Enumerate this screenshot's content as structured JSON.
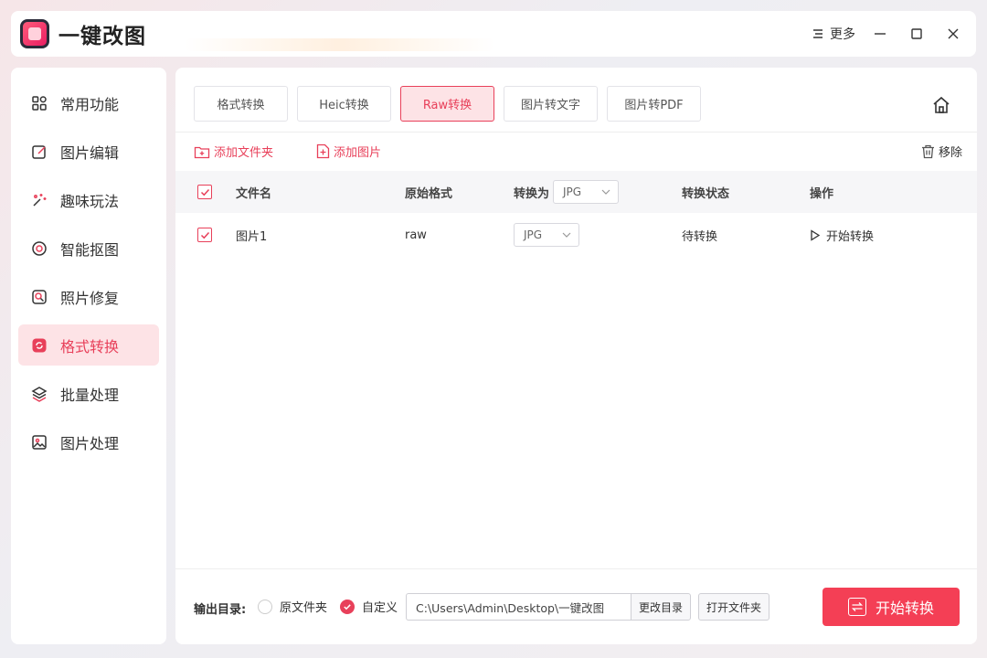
{
  "app": {
    "title": "一键改图"
  },
  "titlebar": {
    "more_label": "更多"
  },
  "sidebar": {
    "items": [
      {
        "label": "常用功能",
        "icon": "grid-icon"
      },
      {
        "label": "图片编辑",
        "icon": "edit-icon"
      },
      {
        "label": "趣味玩法",
        "icon": "sparkle-icon"
      },
      {
        "label": "智能抠图",
        "icon": "target-icon"
      },
      {
        "label": "照片修复",
        "icon": "repair-icon"
      },
      {
        "label": "格式转换",
        "icon": "convert-icon",
        "active": true
      },
      {
        "label": "批量处理",
        "icon": "layers-icon"
      },
      {
        "label": "图片处理",
        "icon": "image-icon"
      }
    ]
  },
  "tabs": [
    {
      "label": "格式转换"
    },
    {
      "label": "Heic转换"
    },
    {
      "label": "Raw转换",
      "active": true
    },
    {
      "label": "图片转文字"
    },
    {
      "label": "图片转PDF"
    }
  ],
  "toolbar": {
    "add_folder": "添加文件夹",
    "add_image": "添加图片",
    "remove": "移除"
  },
  "table": {
    "headers": {
      "filename": "文件名",
      "original_format": "原始格式",
      "convert_to": "转换为",
      "convert_to_value": "JPG",
      "status": "转换状态",
      "action": "操作"
    },
    "rows": [
      {
        "filename": "图片1",
        "original_format": "raw",
        "target_format": "JPG",
        "status": "待转换",
        "action": "开始转换"
      }
    ]
  },
  "footer": {
    "output_label": "输出目录:",
    "option_original": "原文件夹",
    "option_custom": "自定义",
    "path": "C:\\Users\\Admin\\Desktop\\一键改图",
    "change_dir": "更改目录",
    "open_folder": "打开文件夹",
    "start_button": "开始转换"
  },
  "colors": {
    "accent": "#e8405a",
    "accent_bg": "#fde3e6",
    "primary_button": "#f43f55"
  }
}
